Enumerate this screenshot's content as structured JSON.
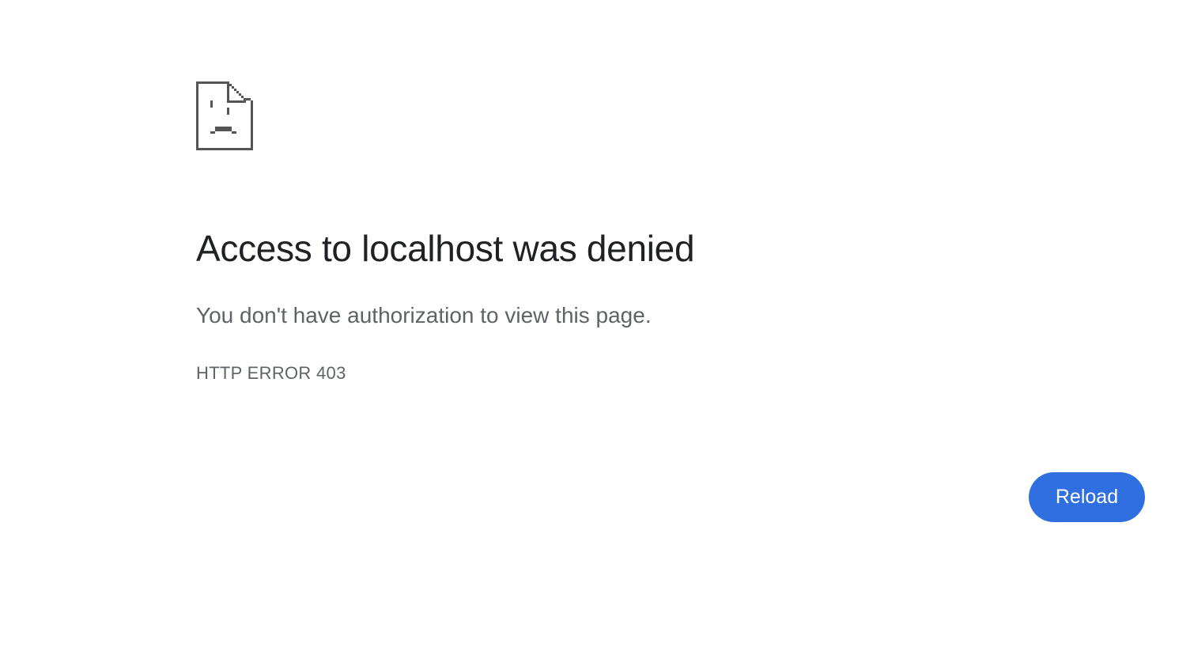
{
  "error_page": {
    "icon": "sad-document-icon",
    "title": "Access to localhost was denied",
    "message": "You don't have authorization to view this page.",
    "error_code": "HTTP ERROR 403",
    "reload_label": "Reload"
  },
  "colors": {
    "background": "#ffffff",
    "title": "#202124",
    "secondary_text": "#5f6368",
    "icon": "#555555",
    "button_bg": "#2f6fe0",
    "button_text": "#ffffff"
  }
}
